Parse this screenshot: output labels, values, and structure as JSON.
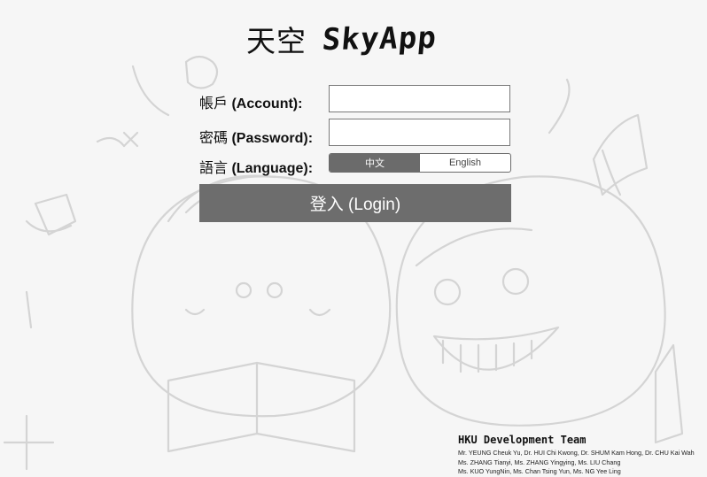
{
  "logo": {
    "chinese": "天空",
    "english": "SkyApp"
  },
  "form": {
    "account_label_cn": "帳戶",
    "account_label_en": "(Account):",
    "account_value": "",
    "password_label_cn": "密碼",
    "password_label_en": "(Password):",
    "password_value": "",
    "language_label_cn": "語言",
    "language_label_en": "(Language):",
    "language_options": [
      "中文",
      "English"
    ],
    "language_selected": "中文",
    "login_label": "登入 (Login)"
  },
  "team": {
    "title": "HKU Development Team",
    "lines": [
      "Mr. YEUNG Cheuk Yu, Dr. HUI Chi Kwong, Dr. SHUM Kam Hong, Dr. CHU Kai Wah",
      "Ms. ZHANG Tianyi, Ms. ZHANG Yingying, Ms. LIU Chang",
      "Ms. KUO YungNin, Ms. Chan Tsing Yun, Ms. NG Yee Ling"
    ]
  },
  "colors": {
    "background": "#f6f6f6",
    "button": "#6d6d6d",
    "toggle_active": "#6b6b6b",
    "sketch_stroke": "#d0d0d0"
  }
}
